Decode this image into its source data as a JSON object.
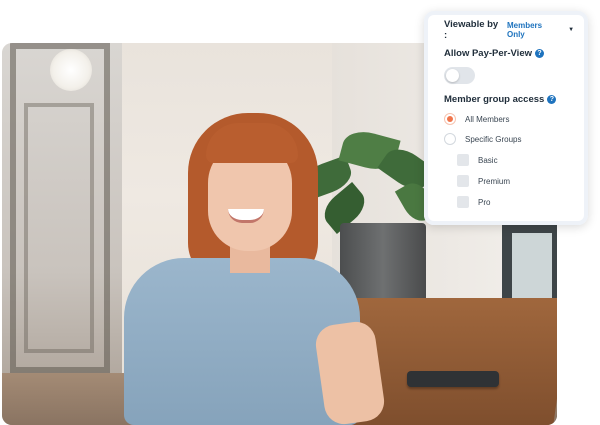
{
  "photo": {
    "alt_subject": "woman-smiling-cafe"
  },
  "settings_card": {
    "viewable_by_label": "Viewable by :",
    "viewable_by_value": "Members Only",
    "pay_per_view_label": "Allow Pay-Per-View",
    "pay_per_view_enabled": false,
    "member_group_label": "Member group access",
    "radio_options": [
      {
        "label": "All Members",
        "selected": true
      },
      {
        "label": "Specific Groups",
        "selected": false
      }
    ],
    "groups": [
      {
        "label": "Basic",
        "checked": false
      },
      {
        "label": "Premium",
        "checked": false
      },
      {
        "label": "Pro",
        "checked": false
      }
    ],
    "help_icon_text": "?",
    "colors": {
      "accent": "#1e73be",
      "radio_selected": "#f0754c",
      "toggle_off": "#e1e5ea"
    }
  }
}
